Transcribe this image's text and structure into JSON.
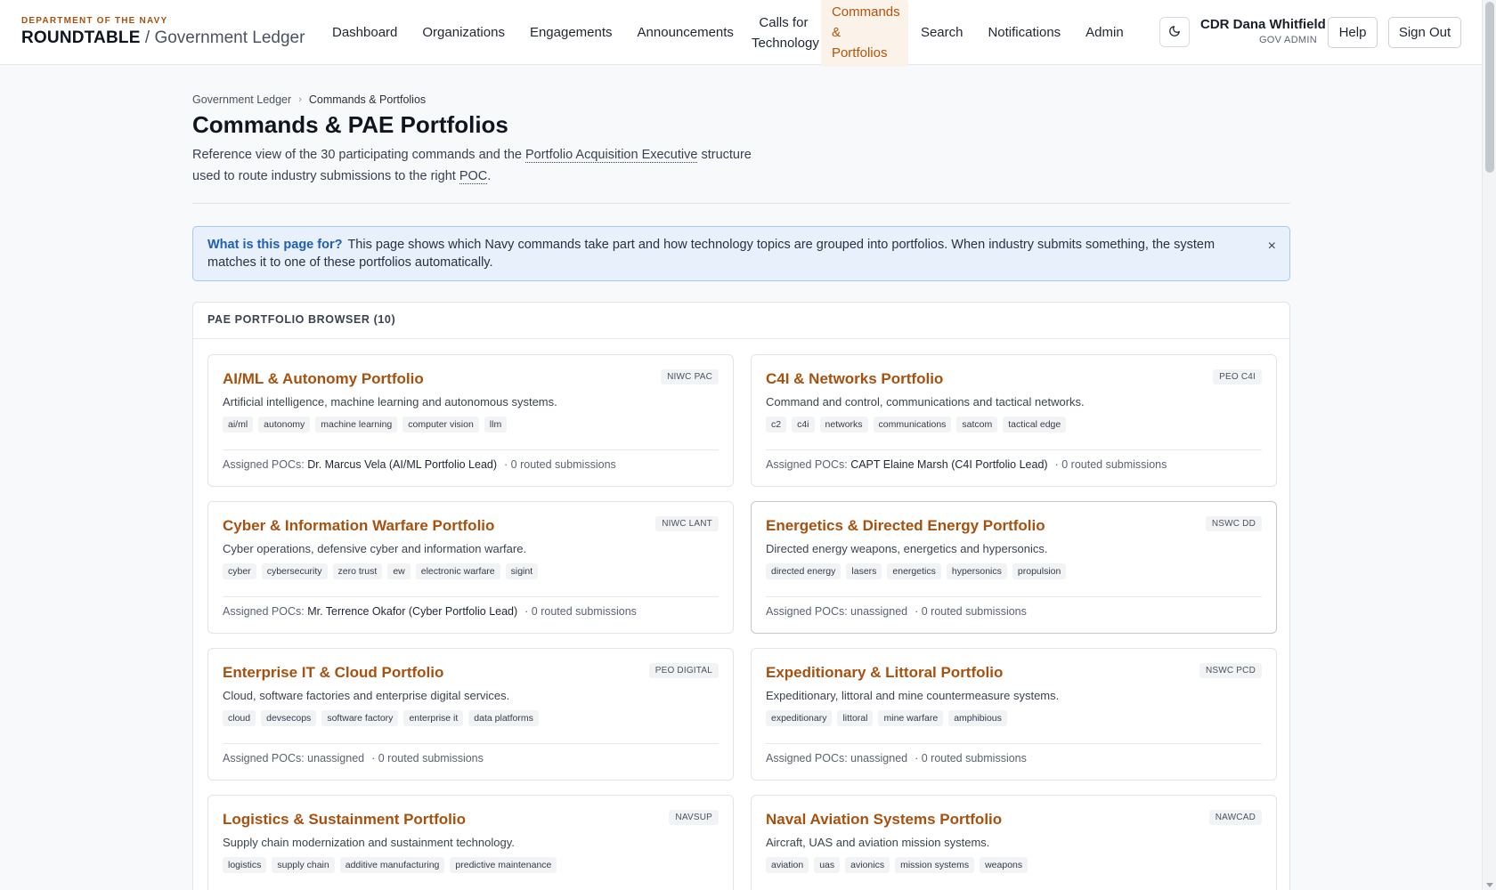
{
  "brand": {
    "kicker": "DEPARTMENT OF THE NAVY",
    "name": "ROUNDTABLE",
    "separator": "/",
    "product": "Government Ledger"
  },
  "nav": {
    "dashboard": "Dashboard",
    "organizations": "Organizations",
    "engagements": "Engagements",
    "announcements": "Announcements",
    "calls_line1": "Calls for",
    "calls_line2": "Technology",
    "commands_line1": "Commands &",
    "commands_line2": "Portfolios",
    "search": "Search",
    "notifications": "Notifications",
    "admin": "Admin"
  },
  "theme_toggle_icon": "moon-icon",
  "user": {
    "name": "CDR Dana Whitfield",
    "role": "GOV ADMIN"
  },
  "buttons": {
    "help": "Help",
    "sign_out": "Sign Out"
  },
  "breadcrumb": {
    "root": "Government Ledger",
    "current": "Commands & Portfolios"
  },
  "page": {
    "title": "Commands & PAE Portfolios",
    "intro_1": "Reference view of the 30 participating commands and the ",
    "intro_abbr_1": "Portfolio Acquisition Executive",
    "intro_2": " structure used to route industry submissions to the right ",
    "intro_abbr_2": "POC",
    "intro_3": "."
  },
  "info": {
    "question": "What is this page for?",
    "text": "This page shows which Navy commands take part and how technology topics are grouped into portfolios. When industry submits something, the system matches it to one of these portfolios automatically.",
    "close": "×"
  },
  "browser": {
    "header": "PAE PORTFOLIO BROWSER (10)"
  },
  "portfolios": [
    {
      "title": "AI/ML & Autonomy Portfolio",
      "code": "NIWC PAC",
      "description": "Artificial intelligence, machine learning and autonomous systems.",
      "tags": [
        "ai/ml",
        "autonomy",
        "machine learning",
        "computer vision",
        "llm"
      ],
      "poc_label": "Assigned POCs: ",
      "poc": "Dr. Marcus Vela (AI/ML Portfolio Lead)",
      "routed": "· 0 routed submissions"
    },
    {
      "title": "C4I & Networks Portfolio",
      "code": "PEO C4I",
      "description": "Command and control, communications and tactical networks.",
      "tags": [
        "c2",
        "c4i",
        "networks",
        "communications",
        "satcom",
        "tactical edge"
      ],
      "poc_label": "Assigned POCs: ",
      "poc": "CAPT Elaine Marsh (C4I Portfolio Lead)",
      "routed": "· 0 routed submissions"
    },
    {
      "title": "Cyber & Information Warfare Portfolio",
      "code": "NIWC LANT",
      "description": "Cyber operations, defensive cyber and information warfare.",
      "tags": [
        "cyber",
        "cybersecurity",
        "zero trust",
        "ew",
        "electronic warfare",
        "sigint"
      ],
      "poc_label": "Assigned POCs: ",
      "poc": "Mr. Terrence Okafor (Cyber Portfolio Lead)",
      "routed": "· 0 routed submissions"
    },
    {
      "title": "Energetics & Directed Energy Portfolio",
      "code": "NSWC DD",
      "description": "Directed energy weapons, energetics and hypersonics.",
      "tags": [
        "directed energy",
        "lasers",
        "energetics",
        "hypersonics",
        "propulsion"
      ],
      "poc_label": "Assigned POCs: unassigned",
      "poc": "",
      "routed": "· 0 routed submissions"
    },
    {
      "title": "Enterprise IT & Cloud Portfolio",
      "code": "PEO DIGITAL",
      "description": "Cloud, software factories and enterprise digital services.",
      "tags": [
        "cloud",
        "devsecops",
        "software factory",
        "enterprise it",
        "data platforms"
      ],
      "poc_label": "Assigned POCs: unassigned",
      "poc": "",
      "routed": "· 0 routed submissions"
    },
    {
      "title": "Expeditionary & Littoral Portfolio",
      "code": "NSWC PCD",
      "description": "Expeditionary, littoral and mine countermeasure systems.",
      "tags": [
        "expeditionary",
        "littoral",
        "mine warfare",
        "amphibious"
      ],
      "poc_label": "Assigned POCs: unassigned",
      "poc": "",
      "routed": "· 0 routed submissions"
    },
    {
      "title": "Logistics & Sustainment Portfolio",
      "code": "NAVSUP",
      "description": "Supply chain modernization and sustainment technology.",
      "tags": [
        "logistics",
        "supply chain",
        "additive manufacturing",
        "predictive maintenance"
      ],
      "poc_label": "",
      "poc": "",
      "routed": ""
    },
    {
      "title": "Naval Aviation Systems Portfolio",
      "code": "NAWCAD",
      "description": "Aircraft, UAS and aviation mission systems.",
      "tags": [
        "aviation",
        "uas",
        "avionics",
        "mission systems",
        "weapons"
      ],
      "poc_label": "",
      "poc": "",
      "routed": ""
    }
  ],
  "colors": {
    "accent": "#a8510f",
    "info_bg": "#e8f0fb",
    "info_border": "#aac8ee",
    "info_link": "#1f5fb5"
  }
}
